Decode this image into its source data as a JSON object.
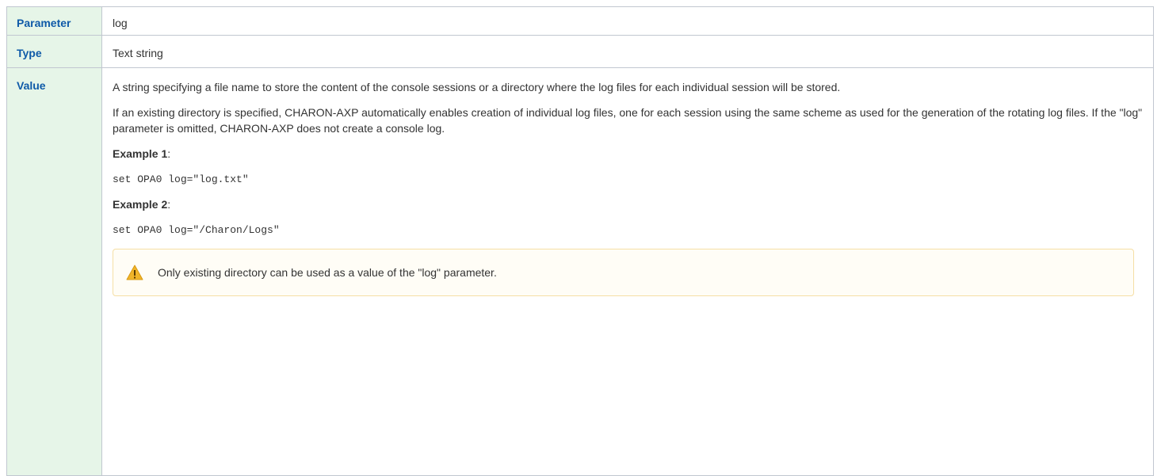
{
  "rows": {
    "parameter": {
      "label": "Parameter",
      "value": "log"
    },
    "type": {
      "label": "Type",
      "value": "Text string"
    },
    "value": {
      "label": "Value",
      "paragraph1": "A string specifying a file name to store the content of the console sessions or a directory where the log files for each individual session will be stored.",
      "paragraph2": "If an existing directory is specified, CHARON-AXP automatically enables creation of individual log files, one for each session using the same scheme as used for the generation of the rotating log files. If the \"log\" parameter is omitted, CHARON-AXP does not create a console log.",
      "example1_label": "Example 1",
      "example1_colon": ":",
      "example1_code": "set OPA0 log=\"log.txt\"",
      "example2_label": "Example 2",
      "example2_colon": ":",
      "example2_code": "set OPA0 log=\"/Charon/Logs\"",
      "note": {
        "icon": "warning-icon",
        "text": "Only existing directory can be used as a value of the \"log\" parameter."
      }
    }
  },
  "colors": {
    "header_bg": "#e6f5e8",
    "header_text": "#0f5aa8",
    "border": "#c1c7d0",
    "note_border": "#f5dfa5",
    "note_bg": "#fffdf6",
    "warning": "#f0b429"
  }
}
